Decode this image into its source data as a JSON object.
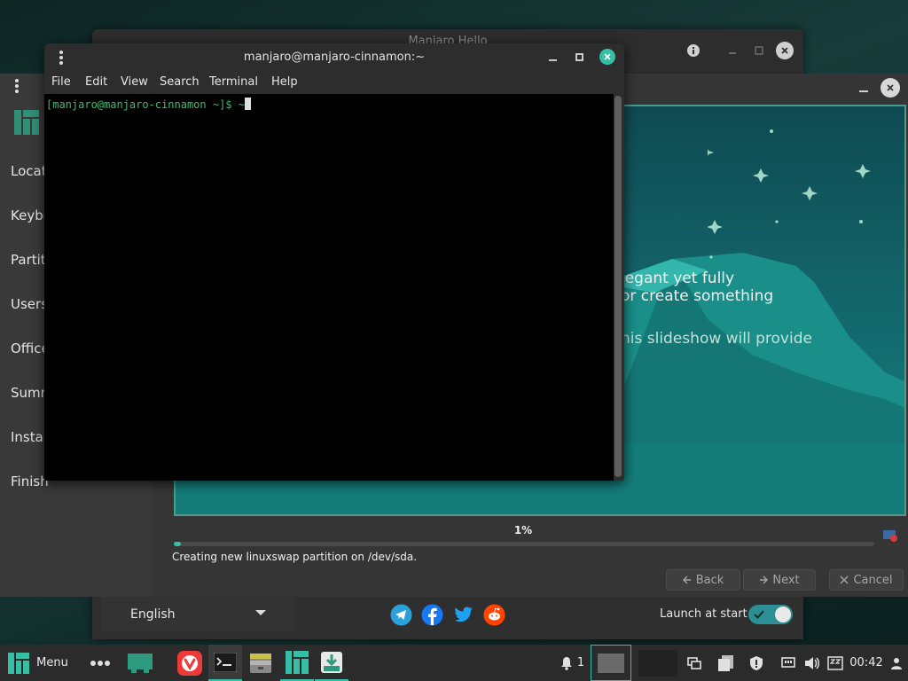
{
  "hello": {
    "title": "Manjaro Hello",
    "language": "English",
    "launch_at_start": "Launch at start",
    "launch_toggle_on": true
  },
  "installer": {
    "sidebar": [
      "Locat",
      "Keybo",
      "Partit",
      "Users",
      "Office",
      "Summ",
      "Instal",
      "Finish"
    ],
    "slide_lines": [
      "legant yet fully",
      "or create something",
      "his slideshow will provide"
    ],
    "progress_percent": 1,
    "progress_label": "1%",
    "status": "Creating new linuxswap partition on /dev/sda.",
    "back": "Back",
    "next": "Next",
    "cancel": "Cancel"
  },
  "terminal": {
    "title": "manjaro@manjaro-cinnamon:~",
    "menu": [
      "File",
      "Edit",
      "View",
      "Search",
      "Terminal",
      "Help"
    ],
    "prompt": "[manjaro@manjaro-cinnamon ~]$ ~"
  },
  "taskbar": {
    "menu_label": "Menu",
    "notification_count": "1",
    "clock": "00:42"
  },
  "colors": {
    "accent": "#35bfa4",
    "terminal_prompt": "#3fbb73",
    "vivaldi": "#ef3939",
    "telegram": "#2aa1da",
    "facebook": "#1877f2",
    "twitter": "#1da1f2",
    "reddit": "#ff4500"
  }
}
